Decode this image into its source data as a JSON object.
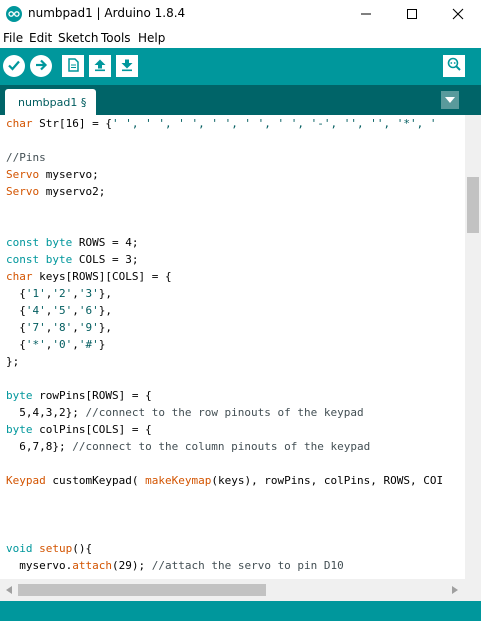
{
  "window": {
    "title": "numbpad1 | Arduino 1.8.4"
  },
  "menu": [
    {
      "label": "File"
    },
    {
      "label": "Edit"
    },
    {
      "label": "Sketch"
    },
    {
      "label": "Tools"
    },
    {
      "label": "Help"
    }
  ],
  "toolbar": {
    "icons": [
      "verify-icon",
      "upload-icon",
      "new-icon",
      "open-icon",
      "save-icon",
      "serial-monitor-icon"
    ]
  },
  "tabs": [
    {
      "label": "numbpad1 §"
    }
  ],
  "code": [
    "char Str[16] = {' ', ' ', ' ', ' ', ' ', ' ', '-', '', '', '*', ' ",
    "",
    "//Pins",
    "Servo myservo;",
    "Servo myservo2;",
    "",
    "",
    "const byte ROWS = 4;",
    "const byte COLS = 3;",
    "char keys[ROWS][COLS] = {",
    "  {'1','2','3'},",
    "  {'4','5','6'},",
    "  {'7','8','9'},",
    "  {'*','0','#'}",
    "};",
    "",
    "byte rowPins[ROWS] = {",
    "  5,4,3,2}; //connect to the row pinouts of the keypad",
    "byte colPins[COLS] = {",
    "  6,7,8}; //connect to the column pinouts of the keypad",
    "",
    "Keypad customKeypad( makeKeymap(keys), rowPins, colPins, ROWS, COI",
    "",
    "",
    "",
    "void setup(){",
    "  myservo.attach(29); //attach the servo to pin D10"
  ],
  "colors": {
    "toolbar": "#00979c",
    "tabbar": "#006468",
    "keyword": "#00979c",
    "type": "#d35400",
    "comment": "#434f54"
  }
}
